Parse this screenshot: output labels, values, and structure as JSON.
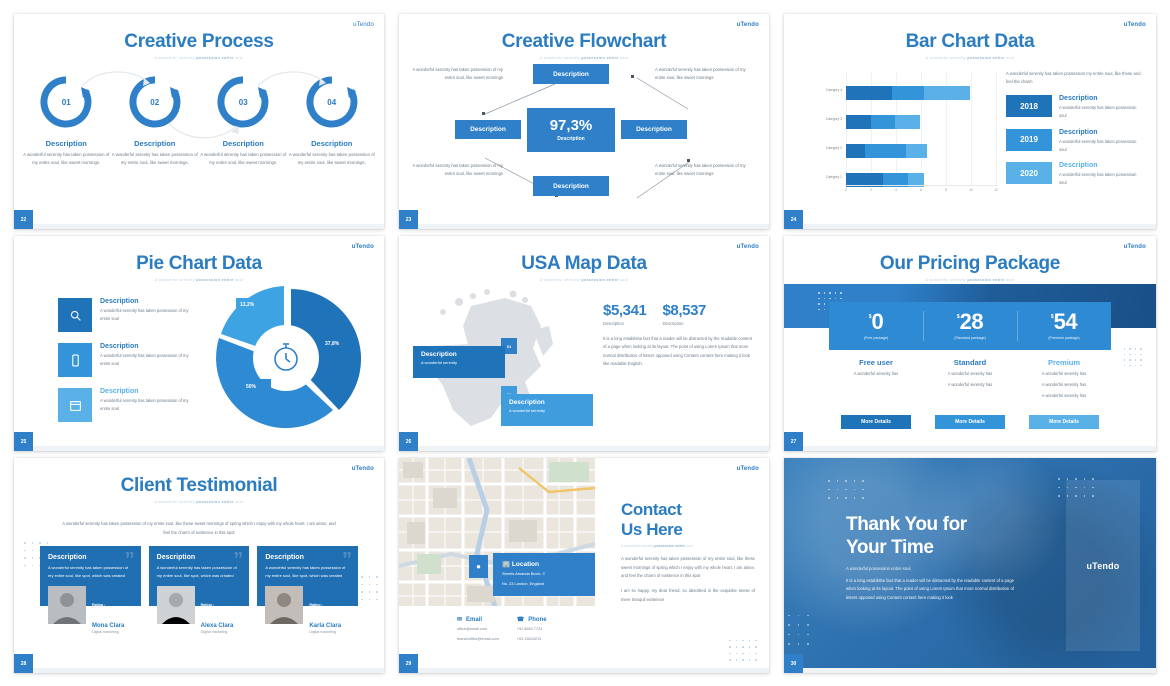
{
  "brand": {
    "logo": "uTendo",
    "accent": "#2f80c8",
    "dark": "#1d5f9e",
    "light": "#4ea3e0"
  },
  "common": {
    "subtitle_pre": "A wonderful serenity ",
    "subtitle_strong": "possession entire",
    "subtitle_post": " soul",
    "description": "Description",
    "lorem_short": "A wonderful serenity has taken possession of my entire soul, like sweet mornings.",
    "lorem_soul": "A wonderful serenity has taken possession of my entire soul"
  },
  "slides": [
    {
      "number": "22",
      "title": "Creative Process",
      "steps": [
        {
          "num": "01",
          "heading": "Description",
          "body": "A wonderful serenity has taken possession of my entire soul, like sweet mornings."
        },
        {
          "num": "02",
          "heading": "Description",
          "body": "A wonderful serenity has taken possession of my entire soul, like sweet mornings."
        },
        {
          "num": "03",
          "heading": "Description",
          "body": "A wonderful serenity has taken possession of my entire soul, like sweet mornings."
        },
        {
          "num": "04",
          "heading": "Description",
          "body": "A wonderful serenity has taken possession of my entire soul, like sweet mornings."
        }
      ]
    },
    {
      "number": "23",
      "title": "Creative Flowchart",
      "center_value": "97,3%",
      "center_label": "Description",
      "boxes": {
        "top": "Description",
        "left": "Description",
        "right": "Description",
        "bottom": "Description"
      },
      "captions": {
        "top_left": "A wonderful serenity has taken possession of my entire soul, like sweet mornings",
        "top_right": "A wonderful serenity has taken possession of my entire soul, like sweet mornings",
        "bottom_left": "A wonderful serenity has taken possession of my entire soul, like sweet mornings",
        "bottom_right": "A wonderful serenity has taken possession of my entire soul, like sweet mornings"
      }
    },
    {
      "number": "24",
      "title": "Bar Chart Data",
      "lead": "A wonderful serenity has taken possession my entire soul, like these and feel the charm",
      "years": [
        {
          "year": "2018",
          "heading": "Description",
          "body": "A wonderful serenity has taken possession soul",
          "color": "#1f73b8"
        },
        {
          "year": "2019",
          "heading": "Description",
          "body": "A wonderful serenity has taken possession soul",
          "color": "#3394da"
        },
        {
          "year": "2020",
          "heading": "Description",
          "body": "A wonderful serenity has taken possession soul",
          "color": "#59b1e8"
        }
      ]
    },
    {
      "number": "25",
      "title": "Pie Chart Data",
      "legend": [
        {
          "icon": "search-icon",
          "heading": "Description",
          "body": "A wonderful serenity has taken possession of my entire soul",
          "color": "#1f73b8"
        },
        {
          "icon": "mobile-icon",
          "heading": "Description",
          "body": "A wonderful serenity has taken possession of my entire soul",
          "color": "#3394da"
        },
        {
          "icon": "calendar-icon",
          "heading": "Description",
          "body": "A wonderful serenity has taken possession of my entire soul",
          "color": "#59b1e8"
        }
      ]
    },
    {
      "number": "26",
      "title": "USA Map Data",
      "pins": [
        {
          "id": "01",
          "heading": "Description",
          "sub": "A wonderful serenity",
          "color": "#2f80c8"
        },
        {
          "id": "02",
          "heading": "Description",
          "sub": "A wonderful serenity",
          "color": "#3f9ddd"
        }
      ],
      "stats": [
        {
          "value": "$5,341",
          "caption": "Description"
        },
        {
          "value": "$8,537",
          "caption": "Description"
        }
      ],
      "body": "It is a long establishe fact that a reader will be distracted by the readable content of a page when looking at its layout. The point of using Lorem Ipsum that more normal distribution of letters opposed using Content content here making it look like readable English."
    },
    {
      "number": "27",
      "title": "Our Pricing Package",
      "plans": [
        {
          "currency": "$",
          "amount": "0",
          "note": "(Free package)",
          "name": "Free user",
          "features": [
            "A wonderful serenity has"
          ],
          "button": "More Details",
          "btn_color": "#1f73b8"
        },
        {
          "currency": "$",
          "amount": "28",
          "note": "(Standard package)",
          "name": "Standard",
          "features": [
            "A wonderful serenity has",
            "A wonderful serenity has"
          ],
          "button": "More Details",
          "btn_color": "#3394da"
        },
        {
          "currency": "$",
          "amount": "54",
          "note": "(Premium package)",
          "name": "Premium",
          "features": [
            "A wonderful serenity has",
            "A wonderful serenity has",
            "A wonderful serenity has"
          ],
          "button": "More Details",
          "btn_color": "#59b1e8"
        }
      ]
    },
    {
      "number": "28",
      "title": "Client Testimonial",
      "lead": "A wonderful serenity has taken possession of my entire soul, like these sweet mornings of spring which I enjoy with my whole heart. I am alone, and feel the charm of existence in this spot",
      "rating_label": "Rating :",
      "stars": "★★★★★",
      "cards": [
        {
          "heading": "Description",
          "body": "A wonderful serenity has taken possession of my entire soul, like spot, which was created",
          "name": "Mona Clara",
          "role": "Digital marketing"
        },
        {
          "heading": "Description",
          "body": "A wonderful serenity has taken possession of my entire soul, like spot, which was created",
          "name": "Alexa Clara",
          "role": "Digital marketing"
        },
        {
          "heading": "Description",
          "body": "A wonderful serenity has taken possession of my entire soul, like spot, which was created",
          "name": "Karla Clara",
          "role": "Digital marketing"
        }
      ]
    },
    {
      "number": "29",
      "title_line1": "Contact",
      "title_line2": "Us Here",
      "location": {
        "heading": "Location",
        "line1": "Streets Amanda Block, C",
        "line2": "No. 23 London, England"
      },
      "email": {
        "heading": "Email",
        "line1": "office@email.com",
        "line2": "branchoffice@email.com"
      },
      "phone": {
        "heading": "Phone",
        "line1": "+52 6654 7723",
        "line2": "+63 33634213"
      },
      "body1": "A wonderful serenity has taken possession of my entire soul, like these sweet mornings of spring which I enjoy with my whole heart. I am alone, and feel the charm of existence in this spot",
      "body2": "I am so happy, my dear friend, so absorbed in the exquisite sense of mere tranquil existence"
    },
    {
      "number": "30",
      "title_line1": "Thank You for",
      "title_line2": "Your Time",
      "subtitle": "A wonderful possession entire soul",
      "body": "It is a long establishe fact that a reader will be distracted by the readable content of a page when looking at its layout. The point of using Lorem Ipsum that more normal distribution of letters opposed using Content content here making it look",
      "panel_logo": "uTendo"
    }
  ],
  "chart_data": [
    {
      "type": "bar",
      "orientation": "horizontal",
      "stacked": true,
      "title": "Bar Chart Data",
      "categories": [
        "Category 1",
        "Category 2",
        "Category 3",
        "Category 4"
      ],
      "series": [
        {
          "name": "2018",
          "color": "#1f73b8",
          "values": [
            4.2,
            1.9,
            2.6,
            4.5
          ]
        },
        {
          "name": "2019",
          "color": "#3394da",
          "values": [
            2.8,
            3.6,
            2.0,
            3.2
          ]
        },
        {
          "name": "2020",
          "color": "#59b1e8",
          "values": [
            1.2,
            1.9,
            1.3,
            4.5
          ]
        }
      ],
      "xlabel": "",
      "ylabel": "",
      "xticks": [
        0,
        2,
        4,
        6,
        8,
        10,
        12
      ],
      "xlim": [
        0,
        12
      ],
      "grid": true,
      "legend": "none"
    },
    {
      "type": "pie",
      "title": "Pie Chart Data",
      "variant": "donut-exploded",
      "labels": [
        "13,2%",
        "37,8%",
        "50%"
      ],
      "values": [
        13.2,
        37.8,
        50
      ],
      "colors": [
        "#3394da",
        "#1f73b8",
        "#2f8ad4"
      ],
      "center_icon": "stopwatch-icon"
    }
  ]
}
